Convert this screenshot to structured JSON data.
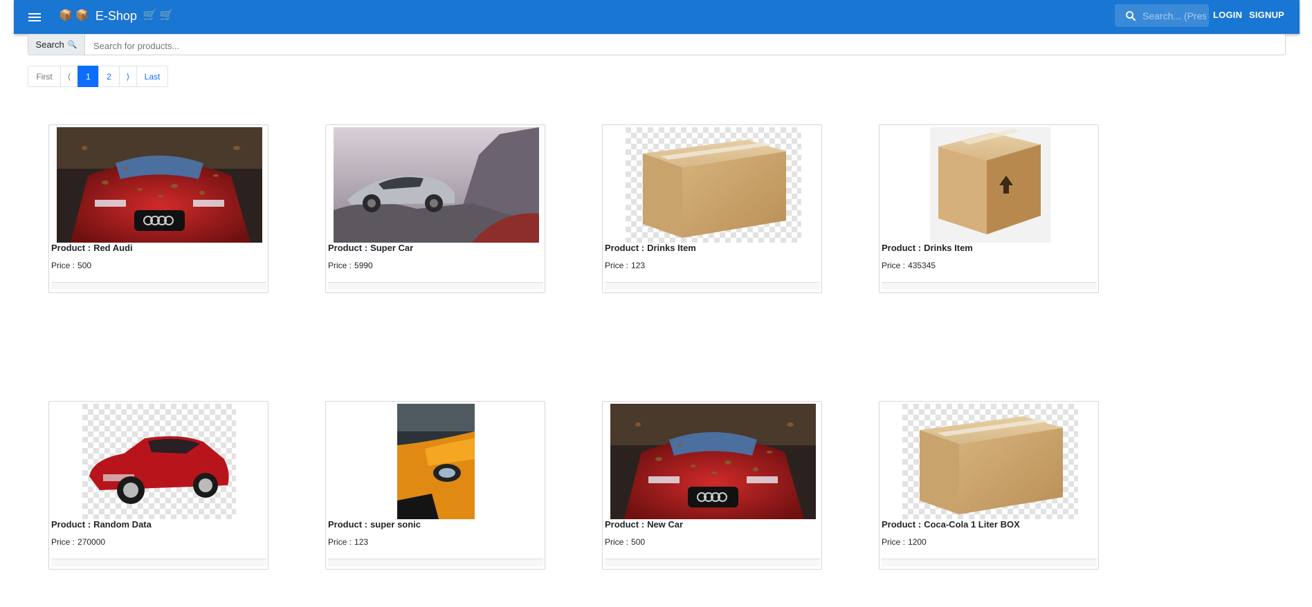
{
  "app": {
    "title": "E-Shop",
    "title_icons": [
      "package-icon",
      "package-icon",
      "cart-icon",
      "cart-icon"
    ],
    "search_placeholder": "Search... (Press /)",
    "login_label": "LOGIN",
    "signup_label": "SIGNUP",
    "bar_color": "#1976d2"
  },
  "search": {
    "button_label": "Search",
    "button_icon": "🔍",
    "placeholder": "Search for products..."
  },
  "pagination": {
    "first": "First",
    "prev": "⟨",
    "pages": [
      "1",
      "2"
    ],
    "active_page": "1",
    "next": "⟩",
    "last": "Last"
  },
  "products": [
    {
      "name_label": "Product :",
      "name": "Red Audi",
      "price_label": "Price :",
      "price": "500",
      "image": "red-car-photo"
    },
    {
      "name_label": "Product :",
      "name": "Super Car",
      "price_label": "Price :",
      "price": "5990",
      "image": "silver-car-photo"
    },
    {
      "name_label": "Product :",
      "name": "Drinks Item",
      "price_label": "Price :",
      "price": "123",
      "image": "cardboard-box-photo"
    },
    {
      "name_label": "Product :",
      "name": "Drinks Item",
      "price_label": "Price :",
      "price": "435345",
      "image": "cardboard-box-photo"
    },
    {
      "name_label": "Product :",
      "name": "Random Data",
      "price_label": "Price :",
      "price": "270000",
      "image": "red-sports-car-photo"
    },
    {
      "name_label": "Product :",
      "name": "super sonic",
      "price_label": "Price :",
      "price": "123",
      "image": "orange-car-photo"
    },
    {
      "name_label": "Product :",
      "name": "New Car",
      "price_label": "Price :",
      "price": "500",
      "image": "red-car-photo"
    },
    {
      "name_label": "Product :",
      "name": "Coca-Cola 1 Liter BOX",
      "price_label": "Price :",
      "price": "1200",
      "image": "cardboard-box-photo"
    }
  ]
}
